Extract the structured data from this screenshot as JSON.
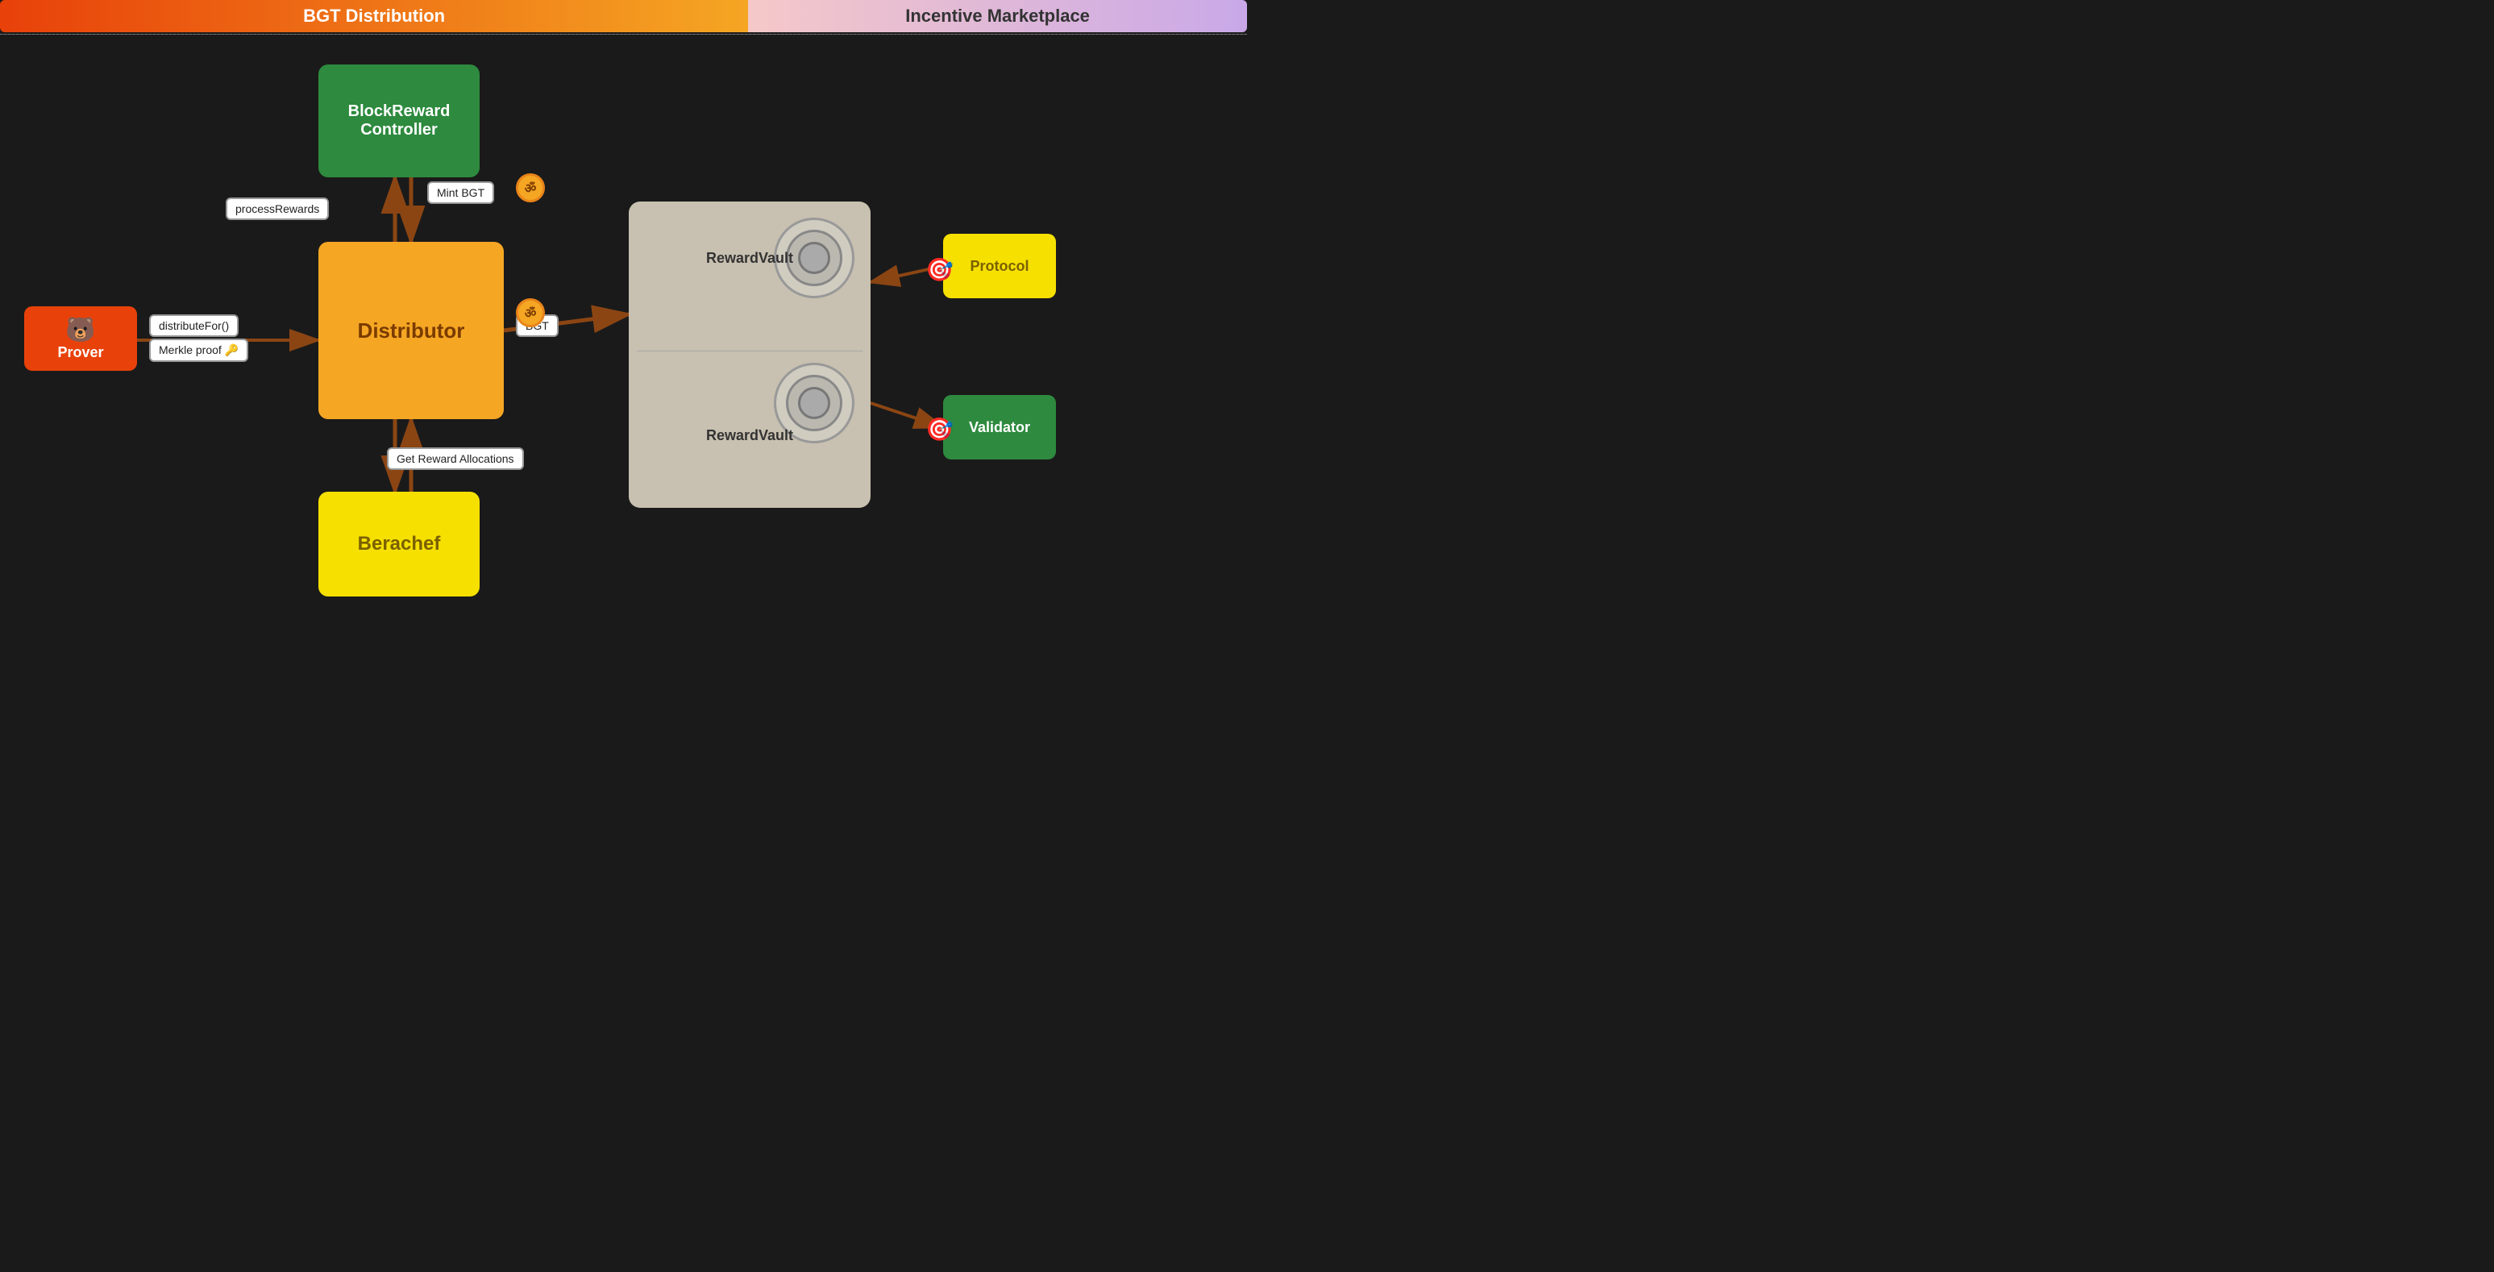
{
  "banner": {
    "left_title": "BGT Distribution",
    "right_title": "Incentive Marketplace"
  },
  "nodes": {
    "block_reward_controller": "BlockReward\nController",
    "distributor": "Distributor",
    "berachef": "Berachef",
    "prover": "Prover",
    "protocol": "Protocol",
    "validator": "Validator",
    "reward_vault_top": "RewardVault",
    "reward_vault_bottom": "RewardVault"
  },
  "labels": {
    "process_rewards": "processRewards",
    "mint_bgt": "Mint BGT",
    "distribute_for": "distributeFor()",
    "merkle_proof": "Merkle proof 🔑",
    "bgt": "BGT",
    "get_reward_allocations": "Get Reward Allocations"
  },
  "icons": {
    "prover_bear": "🐻",
    "bgt_symbol": "ॐ",
    "dotted_circle": "🎯"
  }
}
